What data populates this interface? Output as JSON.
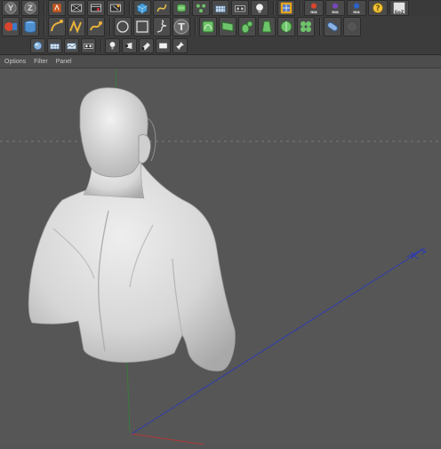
{
  "menu": [
    "Options",
    "Filter",
    "Panel"
  ],
  "toolbar": {
    "row1": [
      {
        "name": "axis-y-lock-icon",
        "glyph": "Y",
        "color": "#c9c9c9"
      },
      {
        "name": "axis-z-lock-icon",
        "glyph": "Z",
        "color": "#c9c9c9"
      },
      {
        "name": "world-coordinates-icon"
      },
      {
        "name": "render-view-icon"
      },
      {
        "name": "render-picture-viewer-icon"
      },
      {
        "name": "render-settings-icon"
      },
      {
        "name": "cube-primitive-icon"
      },
      {
        "name": "spline-pen-icon"
      },
      {
        "name": "subdivision-surface-icon"
      },
      {
        "name": "array-icon"
      },
      {
        "name": "floor-grid-icon"
      },
      {
        "name": "camera-icon"
      },
      {
        "name": "light-bulb-icon"
      },
      {
        "name": "layout-icon"
      },
      {
        "name": "mograph-cloner-icon",
        "label": "mx"
      },
      {
        "name": "mograph-effector-icon",
        "label": "mx"
      },
      {
        "name": "mograph-fracture-icon",
        "label": "mx"
      },
      {
        "name": "help-icon",
        "glyph": "?"
      },
      {
        "name": "goz-icon",
        "label": "GoZ"
      }
    ],
    "row2": [
      {
        "name": "select-object-icon"
      },
      {
        "name": "cylinder-icon"
      },
      {
        "name": "live-selection-icon"
      },
      {
        "name": "move-tool-icon"
      },
      {
        "name": "scale-tool-icon"
      },
      {
        "name": "circle-spline-icon"
      },
      {
        "name": "rectangle-spline-icon"
      },
      {
        "name": "helix-spline-icon"
      },
      {
        "name": "text-spline-icon",
        "glyph": "T"
      },
      {
        "name": "bend-deformer-icon"
      },
      {
        "name": "twist-deformer-icon"
      },
      {
        "name": "bulge-deformer-icon"
      },
      {
        "name": "taper-deformer-icon"
      },
      {
        "name": "sphere-deformer-icon"
      },
      {
        "name": "explosion-deformer-icon"
      },
      {
        "name": "capsule-icon"
      },
      {
        "name": "disabled-tool-icon"
      }
    ],
    "row3": [
      {
        "name": "sphere-primitive-icon"
      },
      {
        "name": "plane-primitive-icon"
      },
      {
        "name": "landscape-icon"
      },
      {
        "name": "stereo-camera-icon"
      },
      {
        "name": "light-icon"
      },
      {
        "name": "spot-light-icon"
      },
      {
        "name": "area-light-icon"
      },
      {
        "name": "background-icon"
      },
      {
        "name": "pin-icon"
      }
    ]
  },
  "colors": {
    "viewport_bg": "#565656",
    "x_axis": "#2c3cb4",
    "y_axis": "#3a7a3a",
    "z_axis": "#b03838",
    "model": "#d8d8d8"
  }
}
